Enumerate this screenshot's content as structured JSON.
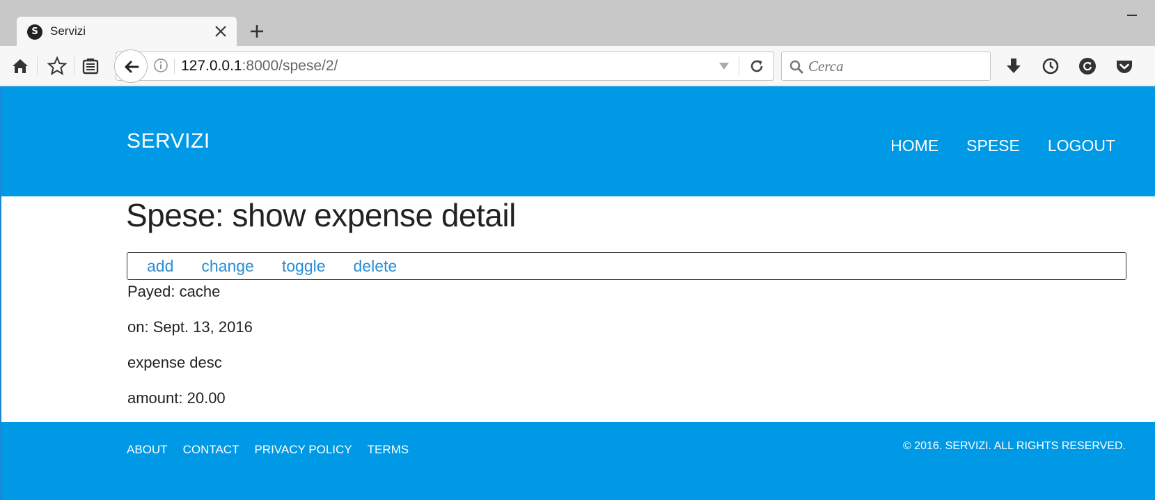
{
  "browser": {
    "tab": {
      "favicon_letter": "S",
      "title": "Servizi"
    },
    "url": {
      "host": "127.0.0.1",
      "rest": ":8000/spese/2/"
    },
    "search": {
      "placeholder": "Cerca"
    }
  },
  "site": {
    "brand": "SERVIZI",
    "nav": [
      "HOME",
      "SPESE",
      "LOGOUT"
    ],
    "accent_color": "#0099e6",
    "link_color": "#2a8dd4"
  },
  "main": {
    "title": "Spese: show expense detail",
    "actions": [
      "add",
      "change",
      "toggle",
      "delete"
    ],
    "details": {
      "payed": "Payed: cache",
      "on": "on: Sept. 13, 2016",
      "description": "expense desc",
      "amount": "amount: 20.00"
    }
  },
  "footer": {
    "links": [
      "ABOUT",
      "CONTACT",
      "PRIVACY POLICY",
      "TERMS"
    ],
    "copyright": "© 2016. SERVIZI. ALL RIGHTS RESERVED."
  },
  "icons": {
    "home": "home-icon",
    "bookmark": "star-icon",
    "library": "library-icon",
    "back": "back-arrow-icon",
    "info": "info-icon",
    "dropdown": "chevron-down-icon",
    "reload": "reload-icon",
    "search": "search-icon",
    "downloads": "download-icon",
    "history": "history-icon",
    "sync": "sync-icon",
    "pocket": "pocket-icon"
  }
}
